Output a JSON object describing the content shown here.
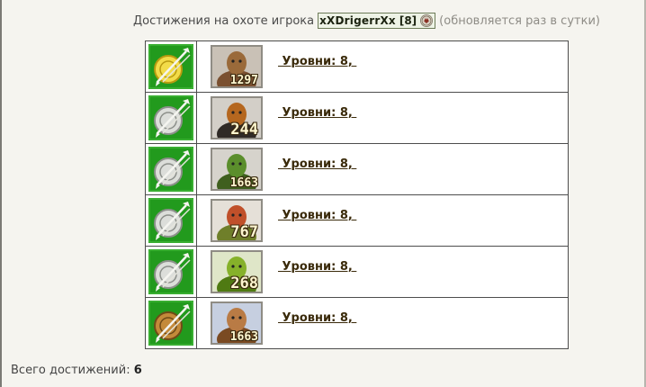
{
  "header": {
    "prefix": "Достижения на охоте игрока",
    "player_name": "xXDrigerrXx",
    "player_level": "[8]",
    "update_note": "(обновляется раз в сутки)"
  },
  "achievements": [
    {
      "medal": "gold-medal-icon",
      "monster": "bat-demon-portrait",
      "count": "1297",
      "levels_text": " Уровни: 8, "
    },
    {
      "medal": "silver-medal-icon",
      "monster": "armored-warrior-portrait",
      "count": "244",
      "levels_text": " Уровни: 8, "
    },
    {
      "medal": "silver-medal-icon",
      "monster": "green-goblin-portrait",
      "count": "1663",
      "levels_text": " Уровни: 8, "
    },
    {
      "medal": "silver-medal-icon",
      "monster": "red-gremlin-portrait",
      "count": "767",
      "levels_text": " Уровни: 8, "
    },
    {
      "medal": "silver-medal-icon",
      "monster": "green-lizard-portrait",
      "count": "268",
      "levels_text": " Уровни: 8, "
    },
    {
      "medal": "bronze-medal-icon",
      "monster": "hooded-monk-portrait",
      "count": "1663",
      "levels_text": " Уровни: 8, "
    }
  ],
  "footer": {
    "total_label": "Всего достижений:",
    "total_value": "6"
  },
  "colors": {
    "medal_background": "#229a1d",
    "gold": "#e8cc2a",
    "silver": "#c9ccc6",
    "bronze": "#a9772e"
  }
}
